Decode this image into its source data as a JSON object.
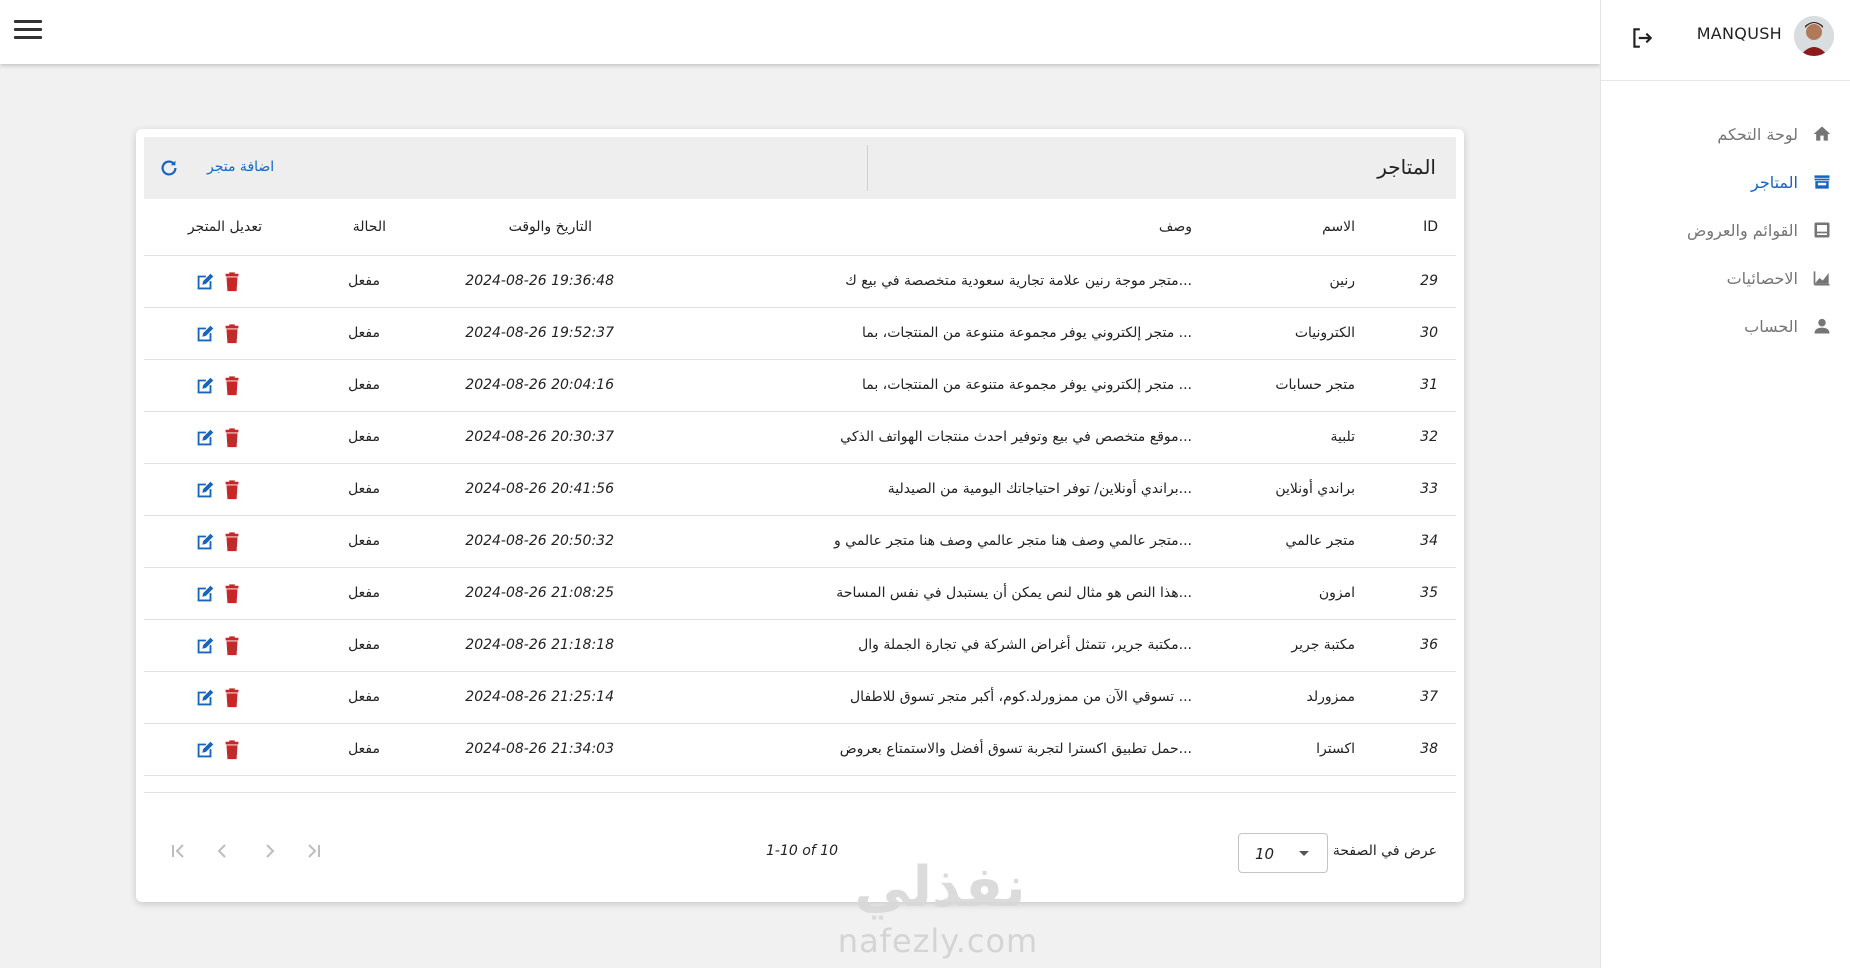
{
  "header": {
    "username": "MANQUSH"
  },
  "sidebar": {
    "items": [
      {
        "label": "لوحة التحكم",
        "icon": "home-icon",
        "active": false
      },
      {
        "label": "المتاجر",
        "icon": "store-icon",
        "active": true
      },
      {
        "label": "القوائم والعروض",
        "icon": "list-alt-icon",
        "active": false
      },
      {
        "label": "الاحصائيات",
        "icon": "stats-chart-icon",
        "active": false
      },
      {
        "label": "الحساب",
        "icon": "person-icon",
        "active": false
      }
    ]
  },
  "page": {
    "title": "المتاجر",
    "add_label": "اضافة متجر"
  },
  "table": {
    "headers": {
      "id": "ID",
      "name": "الاسم",
      "description": "وصف",
      "datetime": "التاريخ والوقت",
      "status": "الحالة",
      "edit": "تعديل المتجر"
    },
    "rows": [
      {
        "id": "29",
        "name": "رنين",
        "description": "متجر موجة رنين علامة تجارية سعودية متخصصة في بيع ك...",
        "datetime": "2024-08-26 19:36:48",
        "status": "مفعل"
      },
      {
        "id": "30",
        "name": "الكترونيات",
        "description": "متجر إلكتروني يوفر مجموعة متنوعة من المنتجات، بما ...",
        "datetime": "2024-08-26 19:52:37",
        "status": "مفعل"
      },
      {
        "id": "31",
        "name": "متجر حسابات",
        "description": "متجر إلكتروني يوفر مجموعة متنوعة من المنتجات، بما ...",
        "datetime": "2024-08-26 20:04:16",
        "status": "مفعل"
      },
      {
        "id": "32",
        "name": "تلبية",
        "description": "موقع متخصص في بيع وتوفير احدث منتجات الهواتف الذكي...",
        "datetime": "2024-08-26 20:30:37",
        "status": "مفعل"
      },
      {
        "id": "33",
        "name": "براندي أونلاين",
        "description": "براندي أونلاين/ توفر احتياجاتك اليومية من الصيدلية...",
        "datetime": "2024-08-26 20:41:56",
        "status": "مفعل"
      },
      {
        "id": "34",
        "name": "متجر عالمي",
        "description": "متجر عالمي وصف هنا متجر عالمي وصف هنا متجر عالمي و...",
        "datetime": "2024-08-26 20:50:32",
        "status": "مفعل"
      },
      {
        "id": "35",
        "name": "امزون",
        "description": "هذا النص هو مثال لنص يمكن أن يستبدل في نفس المساحة...",
        "datetime": "2024-08-26 21:08:25",
        "status": "مفعل"
      },
      {
        "id": "36",
        "name": "مكتبة جرير",
        "description": "مكتبة جرير، تتمثل أغراض الشركة في تجارة الجملة وال...",
        "datetime": "2024-08-26 21:18:18",
        "status": "مفعل"
      },
      {
        "id": "37",
        "name": "ممزورلد",
        "description": "تسوقي الآن من ممزورلد.كوم، أكبر متجر تسوق للاطفال ...",
        "datetime": "2024-08-26 21:25:14",
        "status": "مفعل"
      },
      {
        "id": "38",
        "name": "اكسترا",
        "description": "حمل تطبيق اكسترا لتجربة تسوق أفضل والاستمتاع بعروض...",
        "datetime": "2024-08-26 21:34:03",
        "status": "مفعل"
      }
    ]
  },
  "pagination": {
    "rows_per_page_label": "عرض في الصفحة",
    "rows_per_page": "10",
    "range": "1-10 of 10"
  },
  "watermark": {
    "text": "نفذلي",
    "url": "nafezly.com"
  },
  "colors": {
    "primary": "#1565c0",
    "delete": "#c62828",
    "muted": "#757575"
  }
}
